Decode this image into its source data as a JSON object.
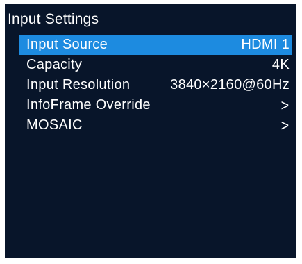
{
  "title": "Input Settings",
  "menu": {
    "items": [
      {
        "label": "Input Source",
        "value": "HDMI 1",
        "selected": true
      },
      {
        "label": "Capacity",
        "value": "4K"
      },
      {
        "label": "Input Resolution",
        "value": "3840×2160@60Hz"
      },
      {
        "label": "InfoFrame Override",
        "value": ">"
      },
      {
        "label": "MOSAIC",
        "value": ">"
      }
    ]
  },
  "colors": {
    "background": "#08152a",
    "highlight": "#1d8be0",
    "text": "#ffffff"
  }
}
